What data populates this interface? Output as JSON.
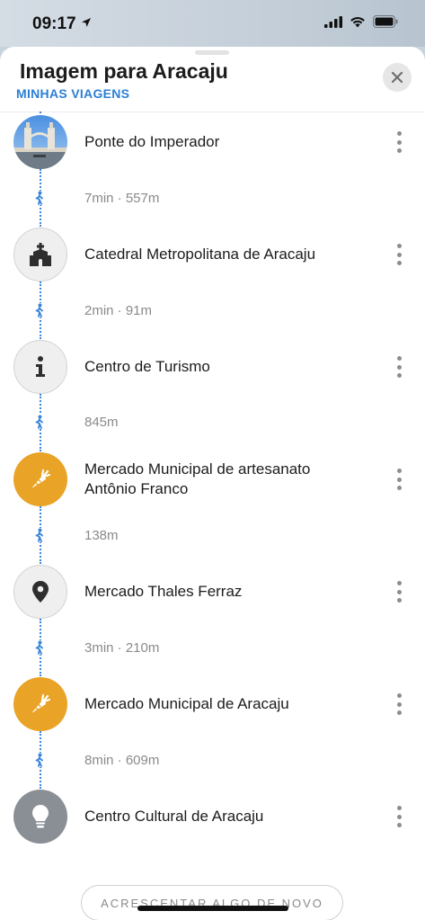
{
  "status_bar": {
    "time": "09:17",
    "icons": [
      "location-arrow-icon",
      "cellular-signal-icon",
      "wifi-icon",
      "battery-icon"
    ]
  },
  "header": {
    "title": "Imagem para Aracaju",
    "subtitle": "MINHAS VIAGENS",
    "close_icon": "close-icon"
  },
  "stops": [
    {
      "name": "Ponte do Imperador",
      "icon": "photo-thumbnail",
      "style": "photo"
    },
    {
      "name": "Catedral Metropolitana de Aracaju",
      "icon": "church-icon",
      "style": "grey"
    },
    {
      "name": "Centro de Turismo",
      "icon": "info-icon",
      "style": "grey"
    },
    {
      "name": "Mercado Municipal de artesanato Antônio Franco",
      "icon": "carrot-icon",
      "style": "orange"
    },
    {
      "name": "Mercado Thales Ferraz",
      "icon": "map-pin-icon",
      "style": "grey"
    },
    {
      "name": "Mercado Municipal de Aracaju",
      "icon": "carrot-icon",
      "style": "orange"
    },
    {
      "name": "Centro Cultural de Aracaju",
      "icon": "lightbulb-icon",
      "style": "dark"
    }
  ],
  "legs": [
    {
      "text": "7min · 557m",
      "icon": "walking-icon"
    },
    {
      "text": "2min · 91m",
      "icon": "walking-icon"
    },
    {
      "text": "845m",
      "icon": "walking-icon"
    },
    {
      "text": "138m",
      "icon": "walking-icon"
    },
    {
      "text": "3min · 210m",
      "icon": "walking-icon"
    },
    {
      "text": "8min · 609m",
      "icon": "walking-icon"
    }
  ],
  "footer": {
    "add_button": "ACRESCENTAR ALGO DE NOVO"
  },
  "colors": {
    "accent_blue": "#2b7fd6",
    "orange": "#e9a327",
    "dark_grey": "#8a8f96"
  }
}
